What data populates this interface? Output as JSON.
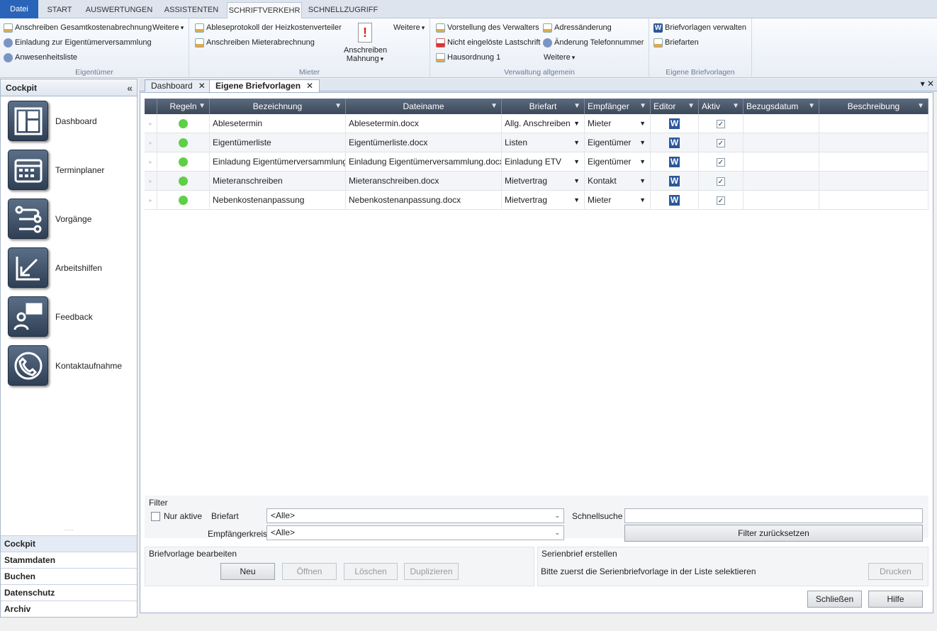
{
  "ribbon_tabs": [
    "Datei",
    "START",
    "AUSWERTUNGEN",
    "ASSISTENTEN",
    "SCHRIFTVERKEHR",
    "SCHNELLZUGRIFF"
  ],
  "ribbon": {
    "eigentuemer": {
      "caption": "Eigentümer",
      "items": [
        "Anschreiben Gesamtkostenabrechnung",
        "Einladung zur Eigentümerversammlung",
        "Anwesenheitsliste"
      ],
      "more": "Weitere"
    },
    "mieter": {
      "caption": "Mieter",
      "items": [
        "Ableseprotokoll der Heizkostenverteiler",
        "Anschreiben Mieterabrechnung"
      ],
      "big_button_line1": "Anschreiben",
      "big_button_line2": "Mahnung",
      "more": "Weitere"
    },
    "verwaltung": {
      "caption": "Verwaltung allgemein",
      "items": [
        "Vorstellung des Verwalters",
        "Nicht eingelöste Lastschrift",
        "Hausordnung 1",
        "Adressänderung",
        "Änderung Telefonnummer"
      ],
      "more": "Weitere"
    },
    "briefvorlagen": {
      "caption": "Eigene Briefvorlagen",
      "items": [
        "Briefvorlagen verwalten",
        "Briefarten"
      ]
    }
  },
  "cockpit": {
    "title": "Cockpit",
    "collapse_glyph": "«",
    "items": [
      "Dashboard",
      "Terminplaner",
      "Vorgänge",
      "Arbeitshilfen",
      "Feedback",
      "Kontaktaufnahme"
    ]
  },
  "nav": [
    "Cockpit",
    "Stammdaten",
    "Buchen",
    "Datenschutz",
    "Archiv"
  ],
  "doc_tabs": [
    "Dashboard",
    "Eigene Briefvorlagen"
  ],
  "grid": {
    "columns": [
      "Regeln",
      "Bezeichnung",
      "Dateiname",
      "Briefart",
      "Empfänger",
      "Editor",
      "Aktiv",
      "Bezugsdatum",
      "Beschreibung"
    ],
    "rows": [
      {
        "bezeichnung": "Ablesetermin",
        "dateiname": "Ablesetermin.docx",
        "briefart": "Allg. Anschreiben",
        "empfaenger": "Mieter",
        "aktiv": "✓"
      },
      {
        "bezeichnung": "Eigentümerliste",
        "dateiname": "Eigentümerliste.docx",
        "briefart": "Listen",
        "empfaenger": "Eigentümer",
        "aktiv": "✓"
      },
      {
        "bezeichnung": "Einladung Eigentümerversammlung",
        "dateiname": "Einladung Eigentümerversammlung.docx",
        "briefart": "Einladung ETV",
        "empfaenger": "Eigentümer",
        "aktiv": "✓"
      },
      {
        "bezeichnung": "Mieteranschreiben",
        "dateiname": "Mieteranschreiben.docx",
        "briefart": "Mietvertrag",
        "empfaenger": "Kontakt",
        "aktiv": "✓"
      },
      {
        "bezeichnung": "Nebenkostenanpassung",
        "dateiname": "Nebenkostenanpassung.docx",
        "briefart": "Mietvertrag",
        "empfaenger": "Mieter",
        "aktiv": "✓"
      }
    ],
    "editor_glyph": "W",
    "status_color": "#5fcf48"
  },
  "filter": {
    "title": "Filter",
    "nur_aktive": "Nur aktive",
    "briefart_label": "Briefart",
    "briefart_value": "<Alle>",
    "empfaengerkreis_label": "Empfängerkreis",
    "empfaengerkreis_value": "<Alle>",
    "schnellsuche_label": "Schnellsuche",
    "reset": "Filter zurücksetzen"
  },
  "bearbeiten": {
    "title": "Briefvorlage bearbeiten",
    "buttons": [
      "Neu",
      "Öffnen",
      "Löschen",
      "Duplizieren"
    ]
  },
  "serienbrief": {
    "title": "Serienbrief erstellen",
    "hint": "Bitte zuerst die Serienbriefvorlage in der Liste selektieren",
    "drucken": "Drucken"
  },
  "footer": {
    "close": "Schließen",
    "help": "Hilfe"
  }
}
